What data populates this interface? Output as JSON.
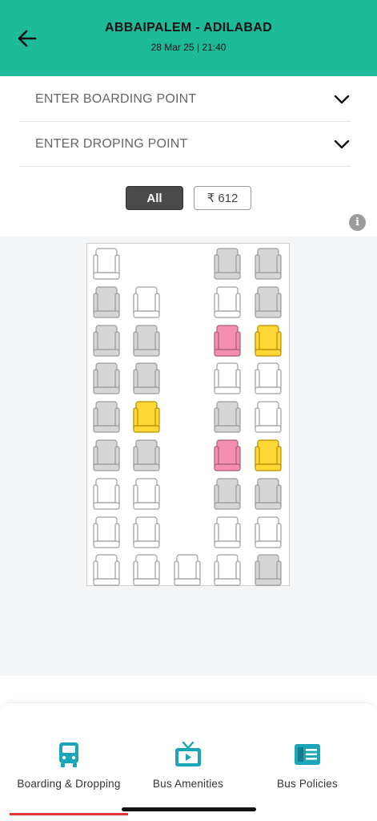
{
  "header": {
    "route": "ABBAIPALEM - ADILABAD",
    "datetime": "28 Mar 25 | 21:40",
    "back_icon": "arrow-left-icon",
    "background": "#1dba9a"
  },
  "selectors": {
    "boarding": "ENTER BOARDING POINT",
    "dropping": "ENTER DROPING POINT"
  },
  "filters": {
    "all": "All",
    "price": "₹ 612"
  },
  "colors": {
    "available": "#ffffff",
    "booked": "#d6d6d6",
    "ladies": "#f48fb1",
    "selected_yellow": "#fdd835"
  },
  "seat_rows": [
    [
      "available",
      null,
      null,
      "booked",
      "booked"
    ],
    [
      "booked",
      "available",
      null,
      "available",
      "booked"
    ],
    [
      "booked",
      "booked",
      null,
      "ladies",
      "yellow"
    ],
    [
      "booked",
      "booked",
      null,
      "available",
      "available"
    ],
    [
      "booked",
      "yellow",
      null,
      "booked",
      "available"
    ],
    [
      "booked",
      "booked",
      null,
      "ladies",
      "yellow"
    ],
    [
      "available",
      "available",
      null,
      "booked",
      "booked"
    ],
    [
      "available",
      "available",
      null,
      "available",
      "available"
    ],
    [
      "available",
      "available",
      "available",
      "available",
      "booked"
    ]
  ],
  "tabs": [
    {
      "label": "Boarding & Dropping",
      "icon": "bus-icon"
    },
    {
      "label": "Bus Amenities",
      "icon": "tv-icon"
    },
    {
      "label": "Bus Policies",
      "icon": "policy-card-icon"
    }
  ]
}
